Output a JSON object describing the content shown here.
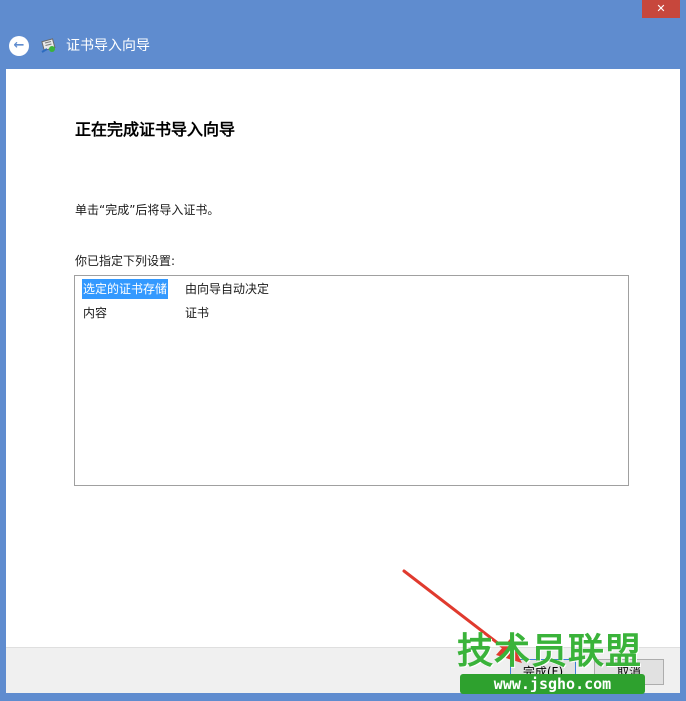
{
  "window": {
    "title": "证书导入向导",
    "close_glyph": "✕",
    "back_glyph": "←"
  },
  "content": {
    "heading": "正在完成证书导入向导",
    "instruction": "单击“完成”后将导入证书。",
    "settings_label": "你已指定下列设置:",
    "settings": [
      {
        "key": "选定的证书存储",
        "value": "由向导自动决定",
        "selected": true
      },
      {
        "key": "内容",
        "value": "证书",
        "selected": false
      }
    ]
  },
  "footer": {
    "finish_label": "完成(F)",
    "cancel_label": "取消"
  },
  "watermark": {
    "title": "技术员联盟",
    "url": "www.jsgho.com"
  },
  "colors": {
    "frame": "#5f8ccf",
    "close_button": "#c7473c",
    "selection": "#3399ff",
    "watermark_green": "#3ab33a",
    "arrow": "#e03a2e"
  },
  "icons": {
    "back": "back-arrow-icon",
    "wizard": "certificate-wizard-icon",
    "close": "close-icon"
  }
}
